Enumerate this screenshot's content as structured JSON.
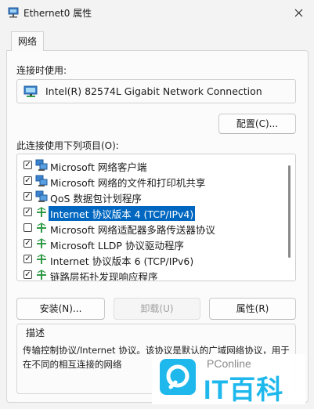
{
  "window": {
    "title": "Ethernet0 属性",
    "close_glyph": "✕"
  },
  "tabs": [
    {
      "label": "网络"
    }
  ],
  "connect_using": {
    "label": "连接时使用:",
    "adapter": "Intel(R) 82574L Gigabit Network Connection",
    "configure_button": "配置(C)..."
  },
  "components": {
    "label": "此连接使用下列项目(O):",
    "items": [
      {
        "label": "Microsoft 网络客户端",
        "checked": true,
        "selected": false,
        "icon": "network-client-icon"
      },
      {
        "label": "Microsoft 网络的文件和打印机共享",
        "checked": true,
        "selected": false,
        "icon": "file-share-icon"
      },
      {
        "label": "QoS 数据包计划程序",
        "checked": true,
        "selected": false,
        "icon": "qos-icon"
      },
      {
        "label": "Internet 协议版本 4 (TCP/IPv4)",
        "checked": true,
        "selected": true,
        "icon": "protocol-icon"
      },
      {
        "label": "Microsoft 网络适配器多路传送器协议",
        "checked": false,
        "selected": false,
        "icon": "protocol-icon"
      },
      {
        "label": "Microsoft LLDP 协议驱动程序",
        "checked": true,
        "selected": false,
        "icon": "protocol-icon"
      },
      {
        "label": "Internet 协议版本 6 (TCP/IPv6)",
        "checked": true,
        "selected": false,
        "icon": "protocol-icon"
      },
      {
        "label": "链路层拓扑发现响应程序",
        "checked": true,
        "selected": false,
        "icon": "protocol-icon"
      }
    ]
  },
  "actions": {
    "install": "安装(N)...",
    "uninstall": "卸载(U)",
    "properties": "属性(R)"
  },
  "description": {
    "title": "描述",
    "text": "传输控制协议/Internet 协议。该协议是默认的广域网络协议，用于在不同的相互连接的网络"
  },
  "watermark": {
    "top": "PConline",
    "main": "IT百科"
  },
  "colors": {
    "selection": "#0067c0",
    "watermark": "#1fb8ec"
  }
}
